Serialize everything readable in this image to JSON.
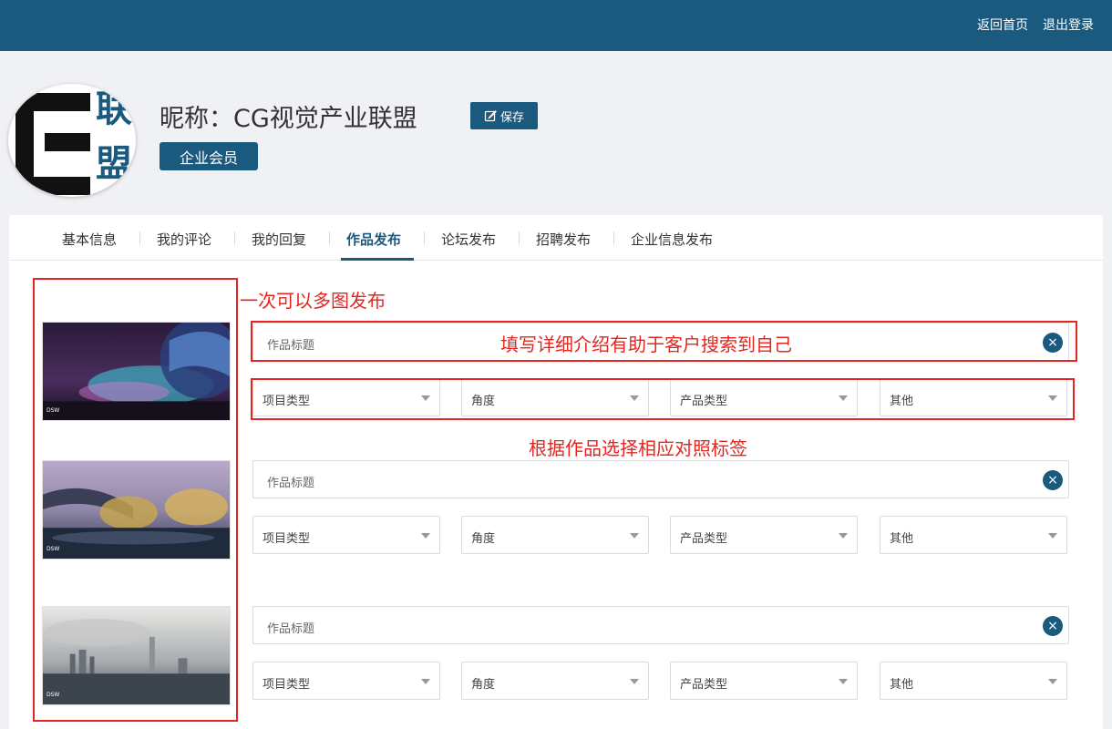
{
  "header": {
    "home_link": "返回首页",
    "logout_link": "退出登录"
  },
  "profile": {
    "avatar_chars": [
      "联",
      "盟"
    ],
    "nickname": "昵称：CG视觉产业联盟",
    "save_label": "保存",
    "member_badge": "企业会员"
  },
  "tabs": [
    "基本信息",
    "我的评论",
    "我的回复",
    "作品发布",
    "论坛发布",
    "招聘发布",
    "企业信息发布"
  ],
  "active_tab": "作品发布",
  "form": {
    "title_placeholder": "作品标题",
    "clear_icon": "×",
    "selects": [
      "项目类型",
      "角度",
      "产品类型",
      "其他"
    ],
    "thumb_logo": "DSW"
  },
  "annotations": {
    "multi_image": "一次可以多图发布",
    "title_tip": "填写详细介绍有助于客户搜索到自己",
    "tag_tip": "根据作品选择相应对照标签"
  },
  "colors": {
    "primary": "#1b5a7f",
    "annotation": "#e3261f"
  }
}
